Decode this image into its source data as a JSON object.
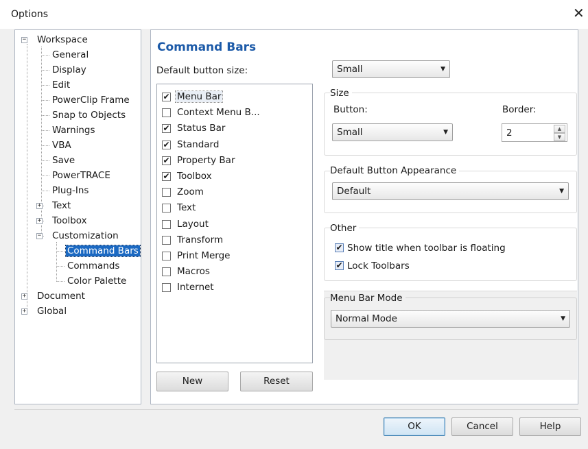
{
  "dialog": {
    "title": "Options",
    "close_glyph": "✕"
  },
  "tree": {
    "nodes": [
      {
        "label": "Workspace",
        "level": 0,
        "expander": "−"
      },
      {
        "label": "General",
        "level": 1
      },
      {
        "label": "Display",
        "level": 1
      },
      {
        "label": "Edit",
        "level": 1
      },
      {
        "label": "PowerClip Frame",
        "level": 1
      },
      {
        "label": "Snap to Objects",
        "level": 1
      },
      {
        "label": "Warnings",
        "level": 1
      },
      {
        "label": "VBA",
        "level": 1
      },
      {
        "label": "Save",
        "level": 1
      },
      {
        "label": "PowerTRACE",
        "level": 1
      },
      {
        "label": "Plug-Ins",
        "level": 1
      },
      {
        "label": "Text",
        "level": 1,
        "expander": "+"
      },
      {
        "label": "Toolbox",
        "level": 1,
        "expander": "+"
      },
      {
        "label": "Customization",
        "level": 1,
        "expander": "−"
      },
      {
        "label": "Command Bars",
        "level": 2,
        "selected": true
      },
      {
        "label": "Commands",
        "level": 2
      },
      {
        "label": "Color Palette",
        "level": 2
      },
      {
        "label": "Document",
        "level": 0,
        "expander": "+"
      },
      {
        "label": "Global",
        "level": 0,
        "expander": "+"
      }
    ]
  },
  "panel": {
    "heading": "Command Bars",
    "default_button_size_label": "Default button size:",
    "default_button_size_value": "Small",
    "command_bars": [
      {
        "label": "Menu Bar",
        "checked": true,
        "focused": true
      },
      {
        "label": "Context Menu B...",
        "checked": false
      },
      {
        "label": "Status Bar",
        "checked": true
      },
      {
        "label": "Standard",
        "checked": true
      },
      {
        "label": "Property Bar",
        "checked": true
      },
      {
        "label": "Toolbox",
        "checked": true
      },
      {
        "label": "Zoom",
        "checked": false
      },
      {
        "label": "Text",
        "checked": false
      },
      {
        "label": "Layout",
        "checked": false
      },
      {
        "label": "Transform",
        "checked": false
      },
      {
        "label": "Print Merge",
        "checked": false
      },
      {
        "label": "Macros",
        "checked": false
      },
      {
        "label": "Internet",
        "checked": false
      }
    ],
    "new_label": "New",
    "reset_label": "Reset",
    "size_group": {
      "label": "Size",
      "button_label": "Button:",
      "button_value": "Small",
      "border_label": "Border:",
      "border_value": "2"
    },
    "appearance_group": {
      "label": "Default Button Appearance",
      "value": "Default"
    },
    "other_group": {
      "label": "Other",
      "show_title_label": "Show title when toolbar is floating",
      "show_title_checked": true,
      "lock_toolbars_label": "Lock Toolbars",
      "lock_toolbars_checked": true
    },
    "menubar_mode_group": {
      "label": "Menu Bar Mode",
      "value": "Normal Mode"
    }
  },
  "footer": {
    "ok_label": "OK",
    "cancel_label": "Cancel",
    "help_label": "Help"
  },
  "glyphs": {
    "check": "✔",
    "dropdown_arrow": "▼",
    "spin_up": "▲",
    "spin_down": "▼"
  }
}
